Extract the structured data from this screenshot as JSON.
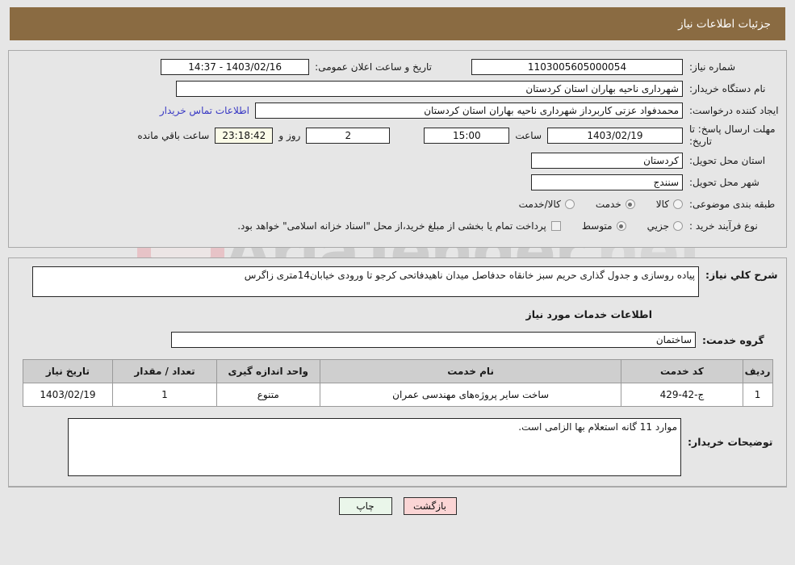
{
  "header": {
    "title": "جزئیات اطلاعات نیاز"
  },
  "colors": {
    "header_bg": "#8a6b42",
    "panel_bg": "#e6e6e6",
    "link": "#3838c4",
    "print_button_bg": "#eaf6ea",
    "back_button_bg": "#fbd5d5",
    "countdown_bg": "#fbfbe8",
    "table_header_bg": "#cfcfcf"
  },
  "form": {
    "need_number_label": "شماره نیاز:",
    "need_number_value": "1103005605000054",
    "announce_datetime_label": "تاریخ و ساعت اعلان عمومی:",
    "announce_datetime_value": "1403/02/16 - 14:37",
    "buyer_org_label": "نام دستگاه خریدار:",
    "buyer_org_value": "شهرداری ناحیه بهاران استان کردستان",
    "requester_label": "ایجاد کننده درخواست:",
    "requester_value": "محمدفواد عزتی کاربرداز شهرداری ناحیه بهاران استان کردستان",
    "contact_link": "اطلاعات تماس خریدار",
    "deadline_label_line1": "مهلت ارسال پاسخ: تا",
    "deadline_label_line2": "تاریخ:",
    "deadline_date": "1403/02/19",
    "hour_label": "ساعت",
    "deadline_time": "15:00",
    "days_remaining": "2",
    "days_label": "روز و",
    "time_remaining": "23:18:42",
    "remaining_label": "ساعت باقي مانده",
    "province_label": "استان محل تحویل:",
    "province_value": "کردستان",
    "city_label": "شهر محل تحویل:",
    "city_value": "سنندج",
    "category_label": "طبقه بندی موضوعی:",
    "category_options": [
      {
        "label": "کالا",
        "checked": false
      },
      {
        "label": "خدمت",
        "checked": true
      },
      {
        "label": "کالا/خدمت",
        "checked": false
      }
    ],
    "process_type_label": "نوع فرآیند خرید :",
    "process_type_options": [
      {
        "label": "جزیي",
        "checked": false
      },
      {
        "label": "متوسط",
        "checked": true
      }
    ],
    "treasury_checkbox_checked": false,
    "treasury_checkbox_label": "پرداخت تمام یا بخشی از مبلغ خرید،از محل \"اسناد خزانه اسلامی\" خواهد بود."
  },
  "description": {
    "label": "شرح کلي نیاز:",
    "value": "پیاده روسازی و جدول گذاری حریم سبز خانقاه حدفاصل میدان ناهیدفاتحی کرجو تا ورودی خیابان14متری زاگرس"
  },
  "services_section": {
    "title": "اطلاعات خدمات مورد نیاز",
    "service_group_label": "گروه خدمت:",
    "service_group_value": "ساختمان"
  },
  "table": {
    "columns": [
      "ردیف",
      "کد خدمت",
      "نام خدمت",
      "واحد اندازه گیری",
      "تعداد / مقدار",
      "تاریخ نیاز"
    ],
    "rows": [
      {
        "row_no": "1",
        "service_code": "ج-42-429",
        "service_name": "ساخت سایر پروژه‌های مهندسی عمران",
        "unit": "متنوع",
        "quantity": "1",
        "need_date": "1403/02/19"
      }
    ]
  },
  "buyer_notes": {
    "label": "توضیحات خریدار:",
    "value": "موارد 11 گانه استعلام بها الزامی است."
  },
  "footer": {
    "print_button": "چاپ",
    "back_button": "بازگشت"
  },
  "watermark": {
    "brand": "AriaTender",
    "domain": ".net"
  }
}
